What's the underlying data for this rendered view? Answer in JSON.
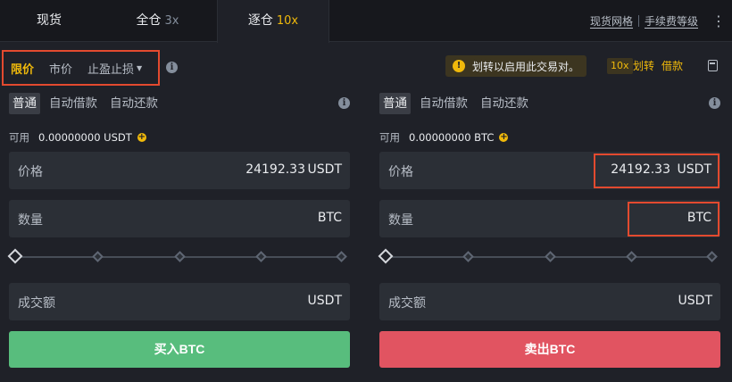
{
  "tabs": [
    {
      "label": "现货",
      "lev": ""
    },
    {
      "label": "全仓",
      "lev": "3x"
    },
    {
      "label": "逐仓",
      "lev": "10x"
    }
  ],
  "top_links": {
    "spot_grid": "现货网格",
    "fee_level": "手续费等级",
    "more_icon": "kebab-icon"
  },
  "order_types": {
    "limit": "限价",
    "market": "市价",
    "stop": "止盈止损"
  },
  "notice": "划转以启用此交易对。",
  "leverage": {
    "badge": "10x",
    "transfer": "划转",
    "borrow": "借款"
  },
  "buy": {
    "modes": [
      "普通",
      "自动借款",
      "自动还款"
    ],
    "avail_label": "可用",
    "avail_value": "0.00000000 USDT",
    "price_label": "价格",
    "price_value": "24192.33",
    "price_unit": "USDT",
    "qty_label": "数量",
    "qty_unit": "BTC",
    "total_label": "成交额",
    "total_unit": "USDT",
    "button": "买入BTC",
    "slider_percent": 0
  },
  "sell": {
    "modes": [
      "普通",
      "自动借款",
      "自动还款"
    ],
    "avail_label": "可用",
    "avail_value": "0.00000000 BTC",
    "price_label": "价格",
    "price_value": "24192.33",
    "price_unit": "USDT",
    "qty_label": "数量",
    "qty_unit": "BTC",
    "total_label": "成交额",
    "total_unit": "USDT",
    "button": "卖出BTC",
    "slider_percent": 0
  },
  "colors": {
    "accent": "#f0b90b",
    "buy": "#58bd7d",
    "sell": "#e15461",
    "highlight": "#e34a2f"
  }
}
